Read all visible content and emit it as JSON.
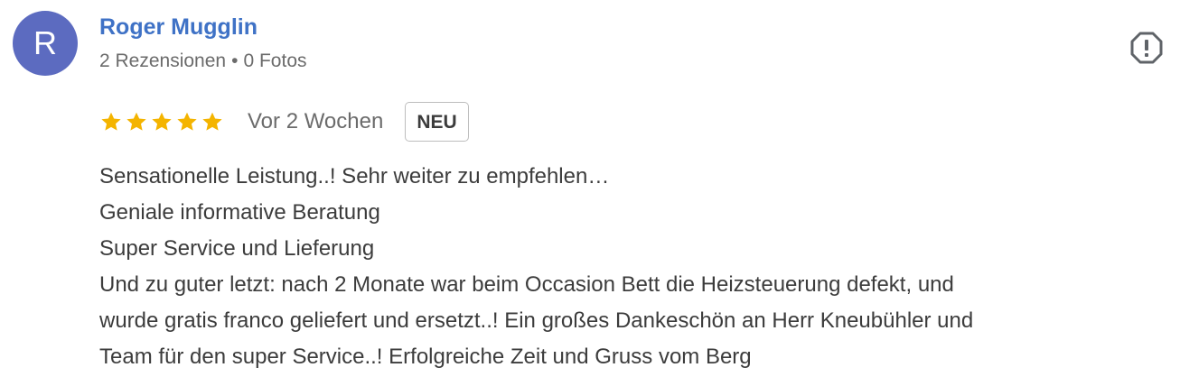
{
  "author": {
    "initial": "R",
    "name": "Roger Mugglin",
    "reviews_count": "2 Rezensionen",
    "separator": "•",
    "photos_count": "0 Fotos",
    "avatar_color": "#5c6bc0"
  },
  "rating": {
    "stars": 5,
    "max_stars": 5,
    "star_color": "#f4b400",
    "date": "Vor 2 Wochen",
    "badge": "NEU"
  },
  "report_icon": "report-flag-octagon-icon",
  "review_lines": [
    "Sensationelle Leistung..! Sehr weiter zu empfehlen…",
    "Geniale informative Beratung",
    "Super Service und Lieferung",
    "Und zu guter letzt: nach 2 Monate war beim Occasion Bett die Heizsteuerung defekt, und",
    "wurde gratis franco geliefert und ersetzt..! Ein großes Dankeschön an Herr Kneubühler und",
    "Team für den super Service..! Erfolgreiche Zeit und Gruss vom Berg"
  ]
}
